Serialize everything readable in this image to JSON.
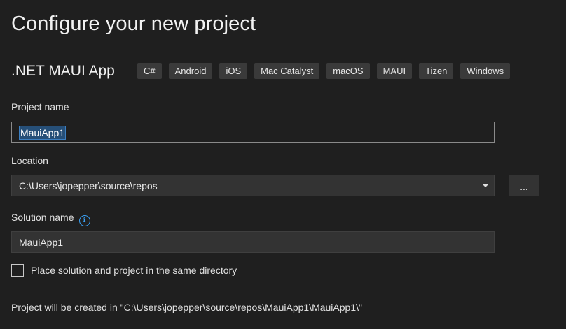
{
  "header": {
    "title": "Configure your new project"
  },
  "template": {
    "name": ".NET MAUI App",
    "tags": [
      "C#",
      "Android",
      "iOS",
      "Mac Catalyst",
      "macOS",
      "MAUI",
      "Tizen",
      "Windows"
    ]
  },
  "project_name": {
    "label": "Project name",
    "value": "MauiApp1"
  },
  "location": {
    "label": "Location",
    "value": "C:\\Users\\jopepper\\source\\repos",
    "browse_label": "..."
  },
  "solution_name": {
    "label": "Solution name",
    "value": "MauiApp1",
    "info_icon": "info-icon"
  },
  "same_directory": {
    "label": "Place solution and project in the same directory",
    "checked": false
  },
  "footer": {
    "note": "Project will be created in \"C:\\Users\\jopepper\\source\\repos\\MauiApp1\\MauiApp1\\\""
  },
  "colors": {
    "background": "#1f1f1f",
    "selection": "#264f78",
    "info_accent": "#3aa0f3"
  }
}
